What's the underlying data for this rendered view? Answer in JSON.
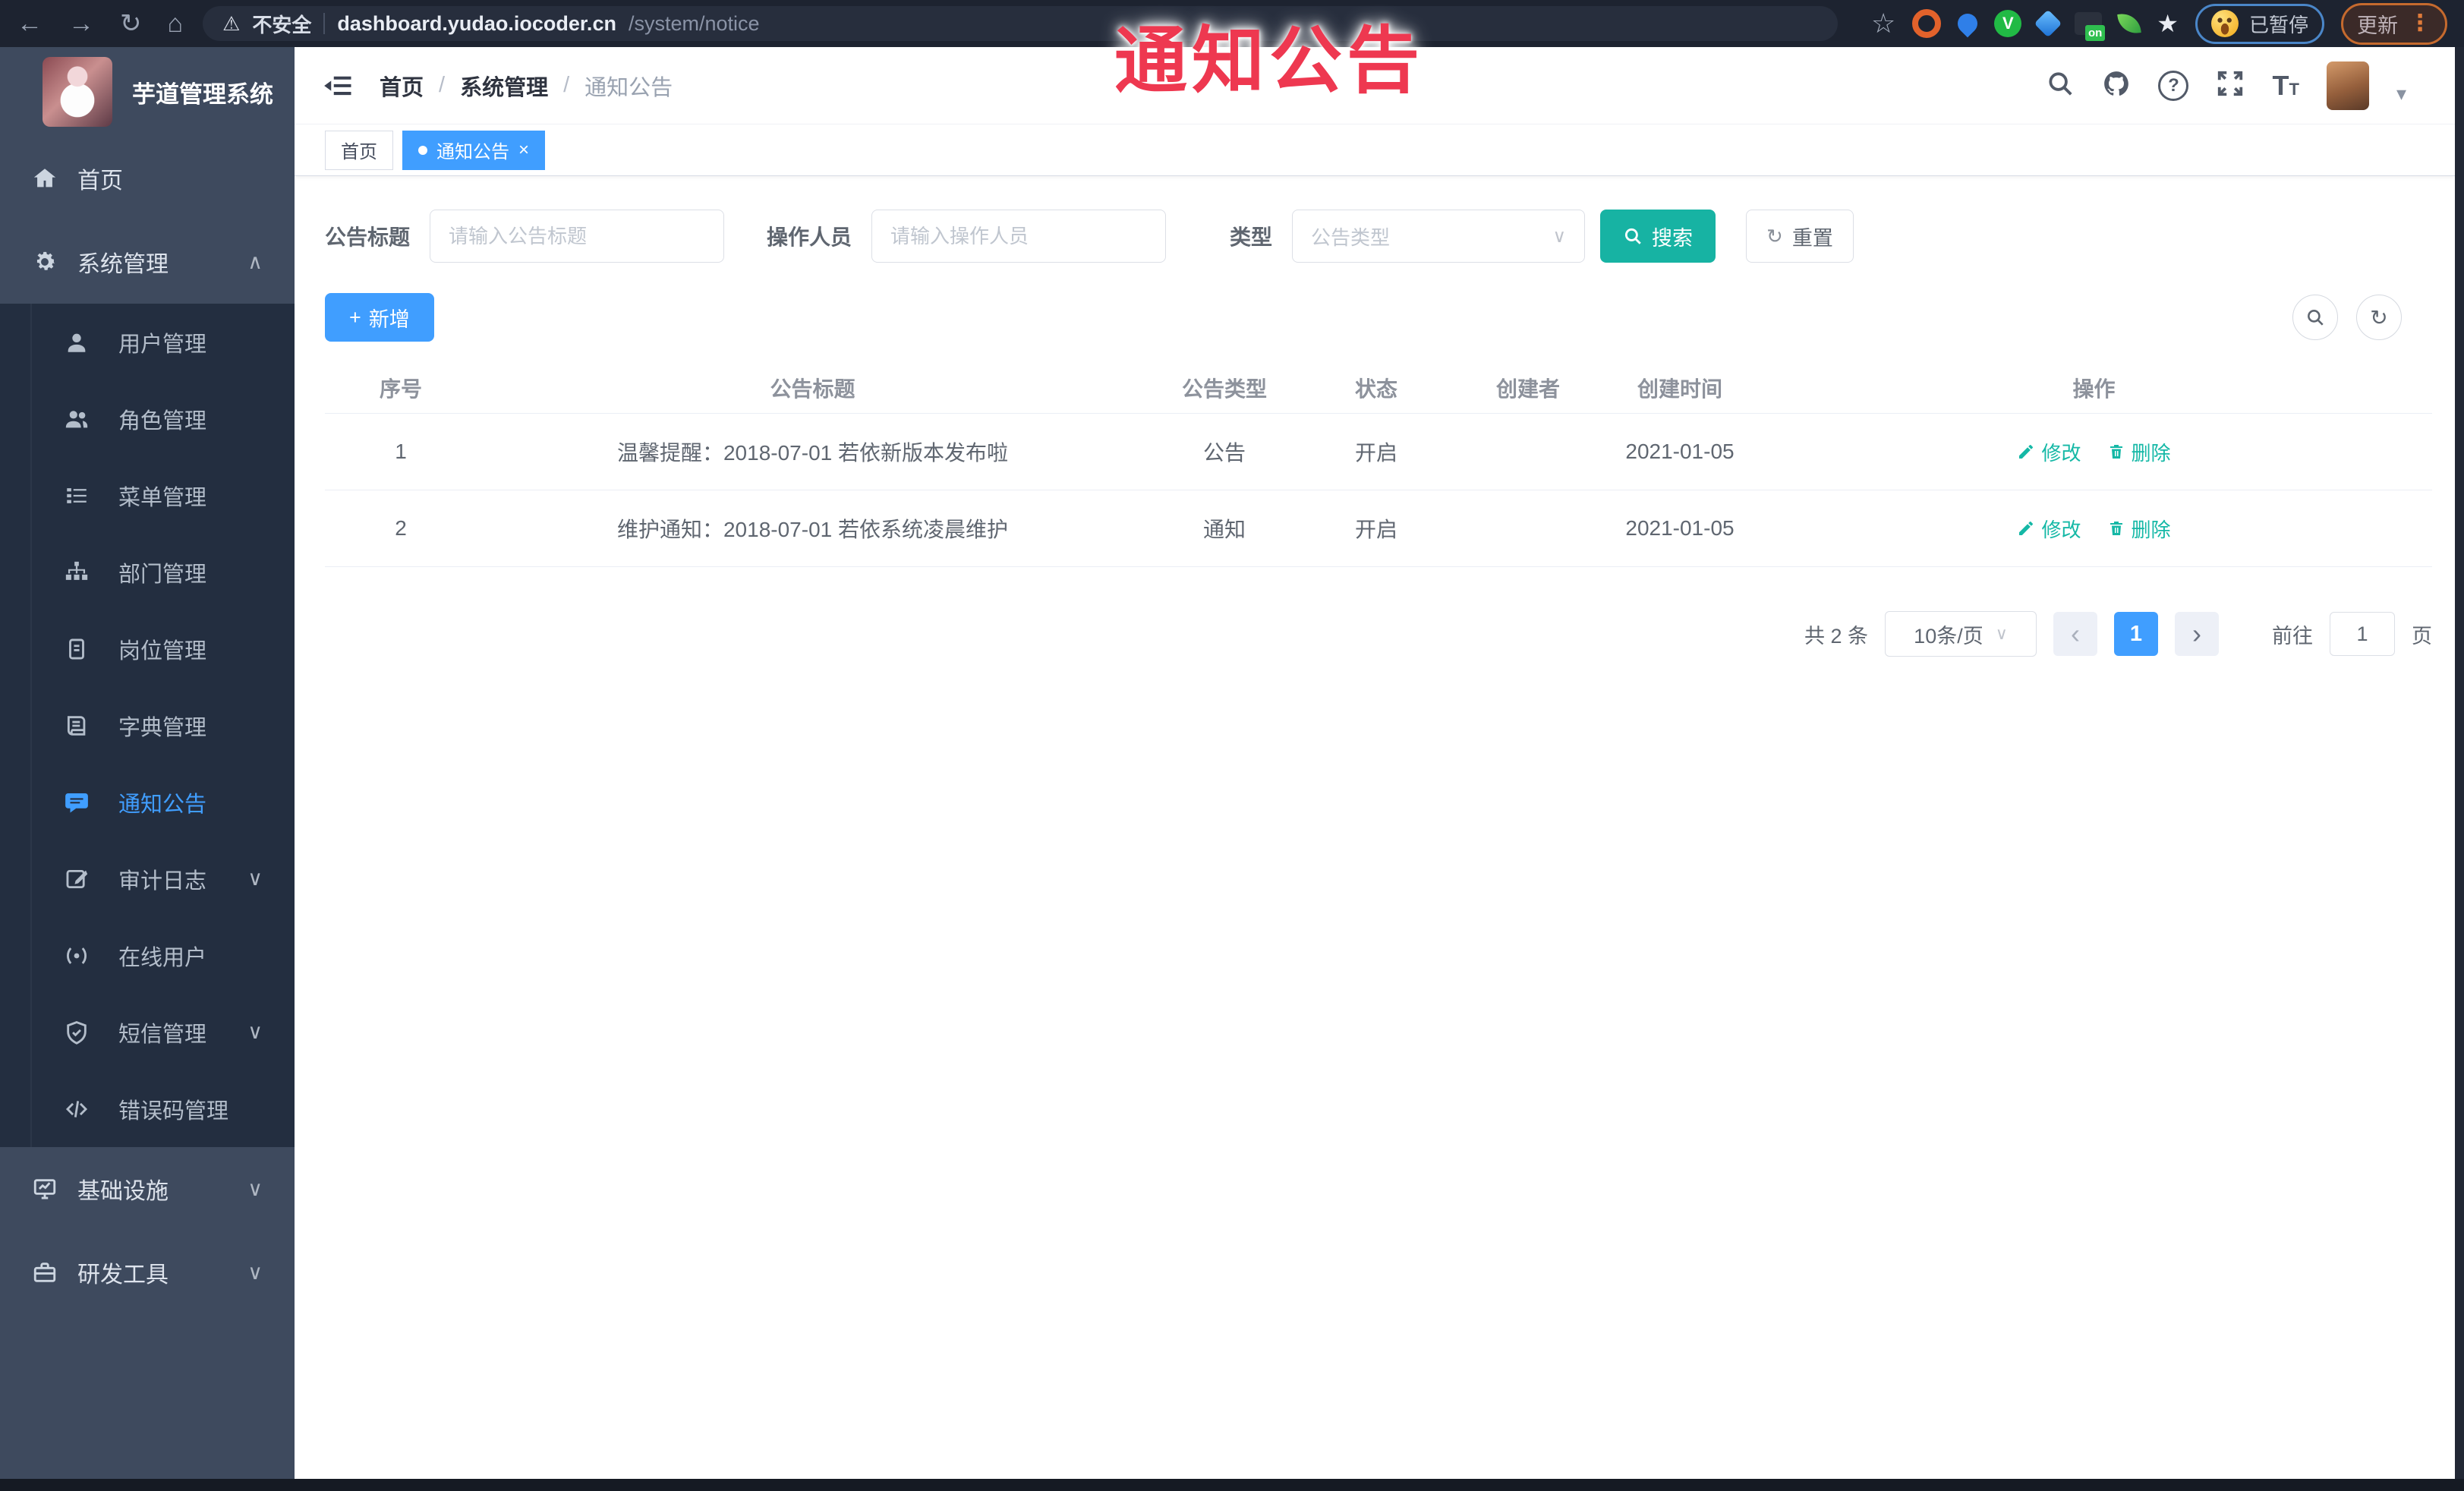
{
  "browser": {
    "security_label": "不安全",
    "url_host": "dashboard.yudao.iocoder.cn",
    "url_path": "/system/notice",
    "paused_label": "已暂停",
    "update_label": "更新",
    "on_badge": "on"
  },
  "icons": {
    "back": "←",
    "forward": "→",
    "reload": "↻",
    "home": "⌂",
    "warning": "⚠",
    "star": "☆",
    "star_filled": "★",
    "kebab": "⋮",
    "caret_down": "▾",
    "chevron_up": "∧",
    "chevron_down": "∨",
    "close": "×",
    "plus": "+",
    "prev": "‹",
    "next": "›",
    "refresh": "↻",
    "question": "?",
    "divider": "/"
  },
  "overlay": {
    "title": "通知公告"
  },
  "sidebar": {
    "logo_title": "芋道管理系统",
    "items": [
      {
        "label": "首页",
        "icon": "home-icon"
      },
      {
        "label": "系统管理",
        "icon": "gear-icon"
      },
      {
        "label": "用户管理",
        "icon": "user-icon"
      },
      {
        "label": "角色管理",
        "icon": "users-icon"
      },
      {
        "label": "菜单管理",
        "icon": "menu-list-icon"
      },
      {
        "label": "部门管理",
        "icon": "org-tree-icon"
      },
      {
        "label": "岗位管理",
        "icon": "badge-icon"
      },
      {
        "label": "字典管理",
        "icon": "book-icon"
      },
      {
        "label": "通知公告",
        "icon": "announcement-icon"
      },
      {
        "label": "审计日志",
        "icon": "log-icon"
      },
      {
        "label": "在线用户",
        "icon": "online-users-icon"
      },
      {
        "label": "短信管理",
        "icon": "sms-icon"
      },
      {
        "label": "错误码管理",
        "icon": "code-icon"
      },
      {
        "label": "基础设施",
        "icon": "infrastructure-icon"
      },
      {
        "label": "研发工具",
        "icon": "devtools-icon"
      }
    ]
  },
  "header": {
    "breadcrumb": [
      "首页",
      "系统管理",
      "通知公告"
    ]
  },
  "tabs": [
    {
      "label": "首页"
    },
    {
      "label": "通知公告"
    }
  ],
  "filters": {
    "title_label": "公告标题",
    "title_placeholder": "请输入公告标题",
    "operator_label": "操作人员",
    "operator_placeholder": "请输入操作人员",
    "type_label": "类型",
    "type_placeholder": "公告类型",
    "search_label": "搜索",
    "reset_label": "重置"
  },
  "toolbar": {
    "add_label": "新增"
  },
  "table": {
    "headers": [
      "序号",
      "公告标题",
      "公告类型",
      "状态",
      "创建者",
      "创建时间",
      "操作"
    ],
    "rows": [
      {
        "no": "1",
        "title": "温馨提醒：2018-07-01 若依新版本发布啦",
        "type": "公告",
        "status": "开启",
        "creator": "",
        "created": "2021-01-05",
        "edit_label": "修改",
        "delete_label": "删除"
      },
      {
        "no": "2",
        "title": "维护通知：2018-07-01 若依系统凌晨维护",
        "type": "通知",
        "status": "开启",
        "creator": "",
        "created": "2021-01-05",
        "edit_label": "修改",
        "delete_label": "删除"
      }
    ]
  },
  "pagination": {
    "total": "共 2 条",
    "page_size": "10条/页",
    "current": "1",
    "goto_label": "前往",
    "goto_value": "1",
    "page_suffix": "页"
  },
  "colors": {
    "accent": "#409eff",
    "search_teal": "#17b3a3",
    "action_link": "#15b8a6",
    "overlay_red": "#ee3850",
    "sidebar_bg": "#3e4a5e",
    "submenu_bg": "#232e40"
  }
}
